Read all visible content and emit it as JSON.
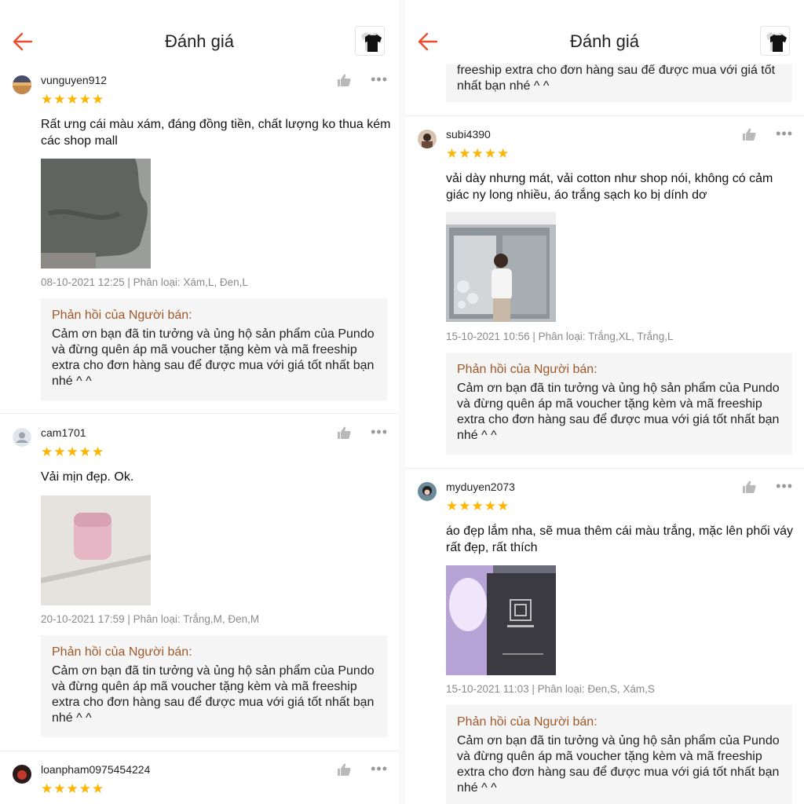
{
  "header": {
    "title": "Đánh giá"
  },
  "colors": {
    "accent": "#ee4d2d",
    "star": "#ffb400",
    "reply_title": "#a0582a"
  },
  "icons": {
    "back": "arrow-left-icon",
    "like": "thumbs-up-icon",
    "more": "more-dots-icon",
    "star": "star-icon"
  },
  "left": {
    "reviews": [
      {
        "username": "vunguyen912",
        "stars": "★★★★★",
        "rating": 5,
        "comment": "Rất ưng cái màu xám, đáng đồng tiền, chất lượng ko thua kém các shop mall",
        "meta": "08-10-2021 12:25 | Phân loại: Xám,L, Đen,L",
        "reply_title": "Phản hồi của Người bán:",
        "reply_text": "Cảm ơn bạn đã tin tưởng và ủng hộ sản phẩm của Pundo và đừng quên áp mã voucher tặng kèm và mã freeship extra cho đơn hàng sau để được mua với giá tốt nhất bạn nhé ^ ^"
      },
      {
        "username": "cam1701",
        "stars": "★★★★★",
        "rating": 5,
        "comment": "Vải mịn đẹp. Ok.",
        "meta": "20-10-2021 17:59 | Phân loại: Trắng,M, Đen,M",
        "reply_title": "Phản hồi của Người bán:",
        "reply_text": "Cảm ơn bạn đã tin tưởng và ủng hộ sản phẩm của Pundo và đừng quên áp mã voucher tặng kèm và mã freeship extra cho đơn hàng sau để được mua với giá tốt nhất bạn nhé ^ ^"
      },
      {
        "username": "loanpham0975454224",
        "stars": "★★★★★",
        "rating": 5
      }
    ]
  },
  "right": {
    "partial_reply_text": "freeship extra cho đơn hàng sau để được mua với giá tốt nhất bạn nhé ^ ^",
    "reviews": [
      {
        "username": "subi4390",
        "stars": "★★★★★",
        "rating": 5,
        "comment": "vải dày nhưng mát, vải cotton như shop nói, không có cảm giác ny long nhiều, áo trắng sạch ko bị dính dơ",
        "meta": "15-10-2021 10:56 | Phân loại: Trắng,XL, Trắng,L",
        "reply_title": "Phản hồi của Người bán:",
        "reply_text": "Cảm ơn bạn đã tin tưởng và ủng hộ sản phẩm của Pundo và đừng quên áp mã voucher tặng kèm và mã freeship extra cho đơn hàng sau để được mua với giá tốt nhất bạn nhé ^ ^"
      },
      {
        "username": "myduyen2073",
        "stars": "★★★★★",
        "rating": 5,
        "comment": "áo đẹp lắm nha, sẽ mua thêm cái màu trắng, mặc lên phối váy rất đẹp, rất thích",
        "meta": "15-10-2021 11:03 | Phân loại: Đen,S, Xám,S",
        "reply_title": "Phản hồi của Người bán:",
        "reply_text": "Cảm ơn bạn đã tin tưởng và ủng hộ sản phẩm của Pundo và đừng quên áp mã voucher tặng kèm và mã freeship extra cho đơn hàng sau để được mua với giá tốt nhất bạn nhé ^ ^"
      }
    ]
  }
}
